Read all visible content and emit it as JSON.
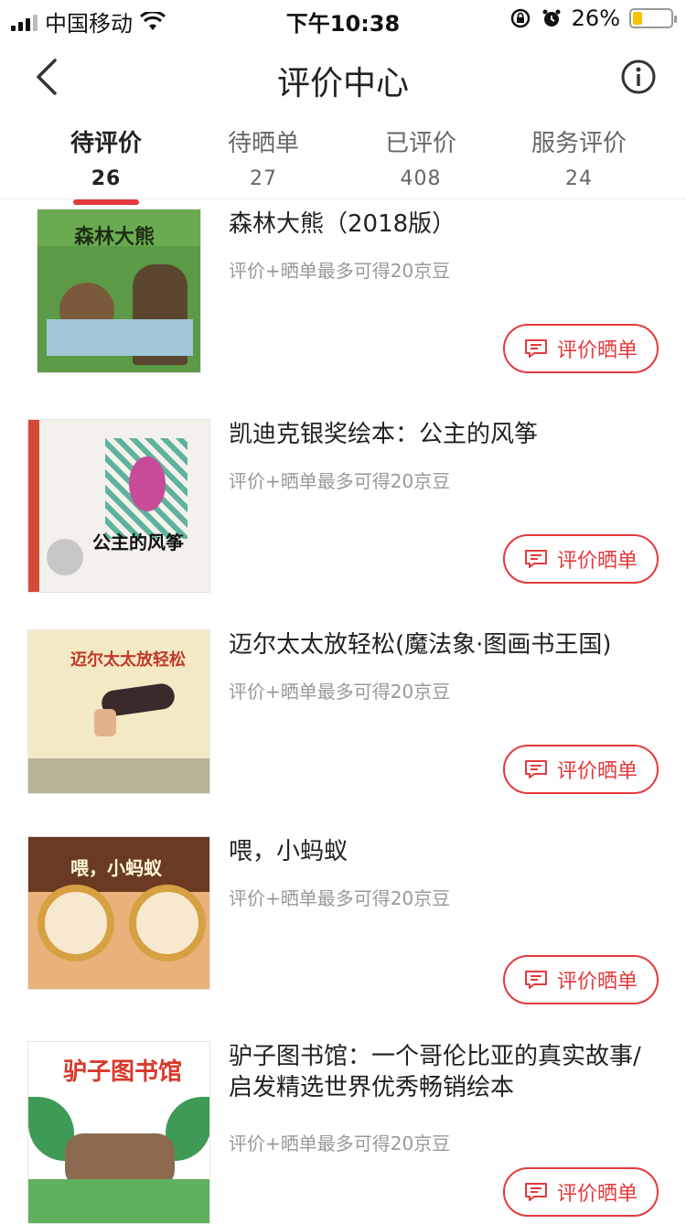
{
  "status": {
    "carrier": "中国移动",
    "time": "下午10:38",
    "battery_percent": "26%",
    "battery_level": 0.26,
    "battery_color": "#f5c400"
  },
  "nav": {
    "title": "评价中心",
    "back_icon": "chevron-left-icon",
    "info_icon": "info-icon"
  },
  "tabs": [
    {
      "label": "待评价",
      "count": "26",
      "active": true
    },
    {
      "label": "待晒单",
      "count": "27",
      "active": false
    },
    {
      "label": "已评价",
      "count": "408",
      "active": false
    },
    {
      "label": "服务评价",
      "count": "24",
      "active": false
    }
  ],
  "accent_color": "#e4393c",
  "items": [
    {
      "name": "森林大熊（2018版）",
      "hint": "评价+晒单最多可得20京豆",
      "button": "评价晒单",
      "cover_text": "森林大熊"
    },
    {
      "name": "凯迪克银奖绘本：公主的风筝",
      "hint": "评价+晒单最多可得20京豆",
      "button": "评价晒单",
      "cover_text": "公主的风筝"
    },
    {
      "name": "迈尔太太放轻松(魔法象·图画书王国)",
      "hint": "评价+晒单最多可得20京豆",
      "button": "评价晒单",
      "cover_text": "迈尔太太放轻松"
    },
    {
      "name": "喂，小蚂蚁",
      "hint": "评价+晒单最多可得20京豆",
      "button": "评价晒单",
      "cover_text": "喂，小蚂蚁"
    },
    {
      "name": "驴子图书馆：一个哥伦比亚的真实故事/启发精选世界优秀畅销绘本",
      "hint": "评价+晒单最多可得20京豆",
      "button": "评价晒单",
      "cover_text": "驴子图书馆"
    }
  ]
}
